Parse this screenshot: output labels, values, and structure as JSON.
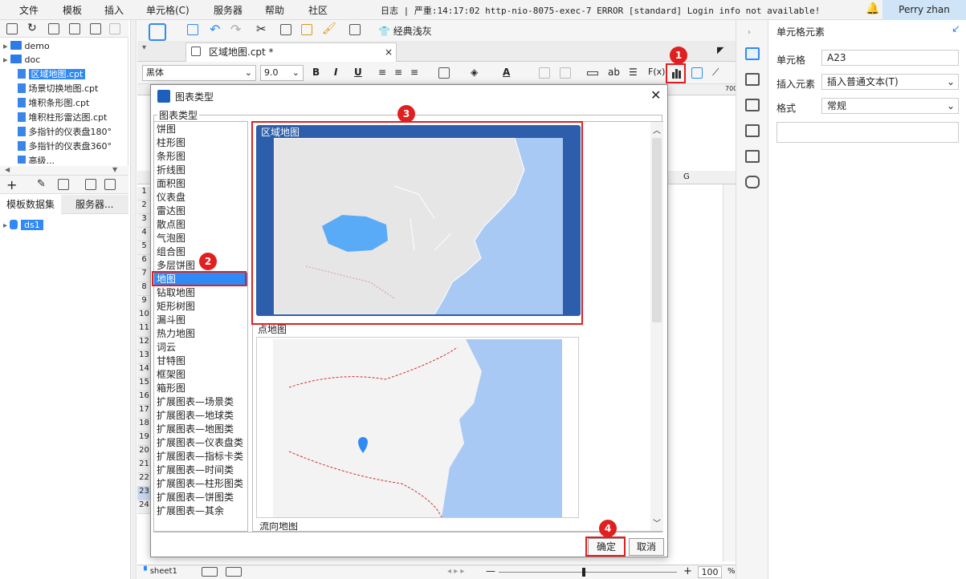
{
  "menu": [
    "文件",
    "模板",
    "插入",
    "单元格(C)",
    "服务器",
    "帮助",
    "社区"
  ],
  "log_line": "日志 | 严重:14:17:02 http-nio-8075-exec-7 ERROR [standard] Login info not available!",
  "user": "Perry zhan",
  "tree": [
    {
      "label": "demo",
      "kind": "folder"
    },
    {
      "label": "doc",
      "kind": "folder"
    },
    {
      "label": "区域地图.cpt",
      "kind": "file",
      "selected": true
    },
    {
      "label": "场景切换地图.cpt",
      "kind": "file"
    },
    {
      "label": "堆积条形图.cpt",
      "kind": "file"
    },
    {
      "label": "堆积柱形雷达图.cpt",
      "kind": "file"
    },
    {
      "label": "多指针的仪表盘180°",
      "kind": "file"
    },
    {
      "label": "多指针的仪表盘360°",
      "kind": "file"
    },
    {
      "label": "高级...",
      "kind": "file"
    }
  ],
  "left_tabs": [
    "模板数据集",
    "服务器..."
  ],
  "datasource": "ds1",
  "toolbar": {
    "theme_label": "经典浅灰"
  },
  "file_tab": "区域地图.cpt *",
  "format": {
    "font": "黑体",
    "size": "9.0",
    "bold": "B",
    "italic": "I",
    "underline": "U",
    "wrap_label": "ab",
    "formula": "F(x)"
  },
  "row_numbers": [
    "1",
    "2",
    "3",
    "4",
    "5",
    "6",
    "7",
    "8",
    "9",
    "10",
    "11",
    "12",
    "13",
    "14",
    "15",
    "16",
    "17",
    "18",
    "19",
    "20",
    "21",
    "22",
    "23",
    "24"
  ],
  "column_g": "G",
  "ruler_mark": "700",
  "sheet_tab": "sheet1",
  "zoom": "100",
  "right_panel": {
    "title": "单元格元素",
    "cell_label": "单元格",
    "cell_value": "A23",
    "insert_label": "插入元素",
    "insert_value": "插入普通文本(T)",
    "format_label": "格式",
    "format_value": "常规"
  },
  "dialog": {
    "title": "图表类型",
    "group_label": "图表类型",
    "types": [
      "饼图",
      "柱形图",
      "条形图",
      "折线图",
      "面积图",
      "仪表盘",
      "雷达图",
      "散点图",
      "气泡图",
      "组合图",
      "多层饼图",
      "地图",
      "钻取地图",
      "矩形树图",
      "漏斗图",
      "热力地图",
      "词云",
      "甘特图",
      "框架图",
      "箱形图",
      "扩展图表—场景类",
      "扩展图表—地球类",
      "扩展图表—地图类",
      "扩展图表—仪表盘类",
      "扩展图表—指标卡类",
      "扩展图表—时间类",
      "扩展图表—柱形图类",
      "扩展图表—饼图类",
      "扩展图表—其余"
    ],
    "selected_type": "地图",
    "previews": [
      "区域地图",
      "点地图"
    ],
    "next_preview": "流向地图",
    "ok": "确定",
    "cancel": "取消"
  },
  "badges": [
    "1",
    "2",
    "3",
    "4"
  ],
  "colors": {
    "accent": "#2f8af5",
    "highlight": "#e02020",
    "map_region": "#5aabf7",
    "land": "#e6e6e6",
    "sea": "#a9c9f5"
  }
}
